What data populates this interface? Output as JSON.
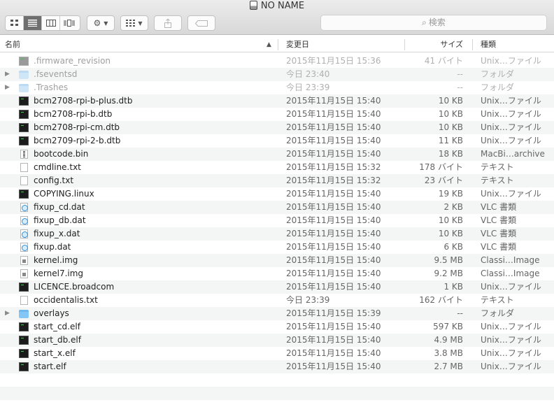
{
  "window": {
    "title": "NO NAME"
  },
  "toolbar": {
    "view_modes": [
      "icon-view",
      "list-view",
      "column-view",
      "coverflow-view"
    ],
    "active_view": 1,
    "action_menu_icon": "gear-icon",
    "arrange_menu_icon": "grid-icon",
    "share_icon": "share-icon",
    "tag_icon": "tag-icon",
    "search_placeholder": "検索"
  },
  "columns": {
    "name": "名前",
    "date": "変更日",
    "size": "サイズ",
    "kind": "種類"
  },
  "files": [
    {
      "name": ".firmware_revision",
      "date": "2015年11月15日 15:36",
      "size": "41 バイト",
      "kind": "Unix…ファイル",
      "icon": "unix-gray",
      "dim": true,
      "folder": false
    },
    {
      "name": ".fseventsd",
      "date": "今日 23:40",
      "size": "--",
      "kind": "フォルダ",
      "icon": "folder-light",
      "dim": true,
      "folder": true
    },
    {
      "name": ".Trashes",
      "date": "今日 23:39",
      "size": "--",
      "kind": "フォルダ",
      "icon": "folder-light",
      "dim": true,
      "folder": true
    },
    {
      "name": "bcm2708-rpi-b-plus.dtb",
      "date": "2015年11月15日 15:40",
      "size": "10 KB",
      "kind": "Unix…ファイル",
      "icon": "unix",
      "dim": false,
      "folder": false
    },
    {
      "name": "bcm2708-rpi-b.dtb",
      "date": "2015年11月15日 15:40",
      "size": "10 KB",
      "kind": "Unix…ファイル",
      "icon": "unix",
      "dim": false,
      "folder": false
    },
    {
      "name": "bcm2708-rpi-cm.dtb",
      "date": "2015年11月15日 15:40",
      "size": "10 KB",
      "kind": "Unix…ファイル",
      "icon": "unix",
      "dim": false,
      "folder": false
    },
    {
      "name": "bcm2709-rpi-2-b.dtb",
      "date": "2015年11月15日 15:40",
      "size": "11 KB",
      "kind": "Unix…ファイル",
      "icon": "unix",
      "dim": false,
      "folder": false
    },
    {
      "name": "bootcode.bin",
      "date": "2015年11月15日 15:40",
      "size": "18 KB",
      "kind": "MacBi…archive",
      "icon": "bin",
      "dim": false,
      "folder": false
    },
    {
      "name": "cmdline.txt",
      "date": "2015年11月15日 15:32",
      "size": "178 バイト",
      "kind": "テキスト",
      "icon": "doc",
      "dim": false,
      "folder": false
    },
    {
      "name": "config.txt",
      "date": "2015年11月15日 15:32",
      "size": "23 バイト",
      "kind": "テキスト",
      "icon": "doc",
      "dim": false,
      "folder": false
    },
    {
      "name": "COPYING.linux",
      "date": "2015年11月15日 15:40",
      "size": "19 KB",
      "kind": "Unix…ファイル",
      "icon": "unix",
      "dim": false,
      "folder": false
    },
    {
      "name": "fixup_cd.dat",
      "date": "2015年11月15日 15:40",
      "size": "2 KB",
      "kind": "VLC 書類",
      "icon": "vlc",
      "dim": false,
      "folder": false
    },
    {
      "name": "fixup_db.dat",
      "date": "2015年11月15日 15:40",
      "size": "10 KB",
      "kind": "VLC 書類",
      "icon": "vlc",
      "dim": false,
      "folder": false
    },
    {
      "name": "fixup_x.dat",
      "date": "2015年11月15日 15:40",
      "size": "10 KB",
      "kind": "VLC 書類",
      "icon": "vlc",
      "dim": false,
      "folder": false
    },
    {
      "name": "fixup.dat",
      "date": "2015年11月15日 15:40",
      "size": "6 KB",
      "kind": "VLC 書類",
      "icon": "vlc",
      "dim": false,
      "folder": false
    },
    {
      "name": "kernel.img",
      "date": "2015年11月15日 15:40",
      "size": "9.5 MB",
      "kind": "Classi…Image",
      "icon": "img",
      "dim": false,
      "folder": false
    },
    {
      "name": "kernel7.img",
      "date": "2015年11月15日 15:40",
      "size": "9.2 MB",
      "kind": "Classi…Image",
      "icon": "img",
      "dim": false,
      "folder": false
    },
    {
      "name": "LICENCE.broadcom",
      "date": "2015年11月15日 15:40",
      "size": "1 KB",
      "kind": "Unix…ファイル",
      "icon": "unix",
      "dim": false,
      "folder": false
    },
    {
      "name": "occidentalis.txt",
      "date": "今日 23:39",
      "size": "162 バイト",
      "kind": "テキスト",
      "icon": "doc",
      "dim": false,
      "folder": false
    },
    {
      "name": "overlays",
      "date": "2015年11月15日 15:39",
      "size": "--",
      "kind": "フォルダ",
      "icon": "folder",
      "dim": false,
      "folder": true
    },
    {
      "name": "start_cd.elf",
      "date": "2015年11月15日 15:40",
      "size": "597 KB",
      "kind": "Unix…ファイル",
      "icon": "unix",
      "dim": false,
      "folder": false
    },
    {
      "name": "start_db.elf",
      "date": "2015年11月15日 15:40",
      "size": "4.9 MB",
      "kind": "Unix…ファイル",
      "icon": "unix",
      "dim": false,
      "folder": false
    },
    {
      "name": "start_x.elf",
      "date": "2015年11月15日 15:40",
      "size": "3.8 MB",
      "kind": "Unix…ファイル",
      "icon": "unix",
      "dim": false,
      "folder": false
    },
    {
      "name": "start.elf",
      "date": "2015年11月15日 15:40",
      "size": "2.7 MB",
      "kind": "Unix…ファイル",
      "icon": "unix",
      "dim": false,
      "folder": false
    }
  ]
}
